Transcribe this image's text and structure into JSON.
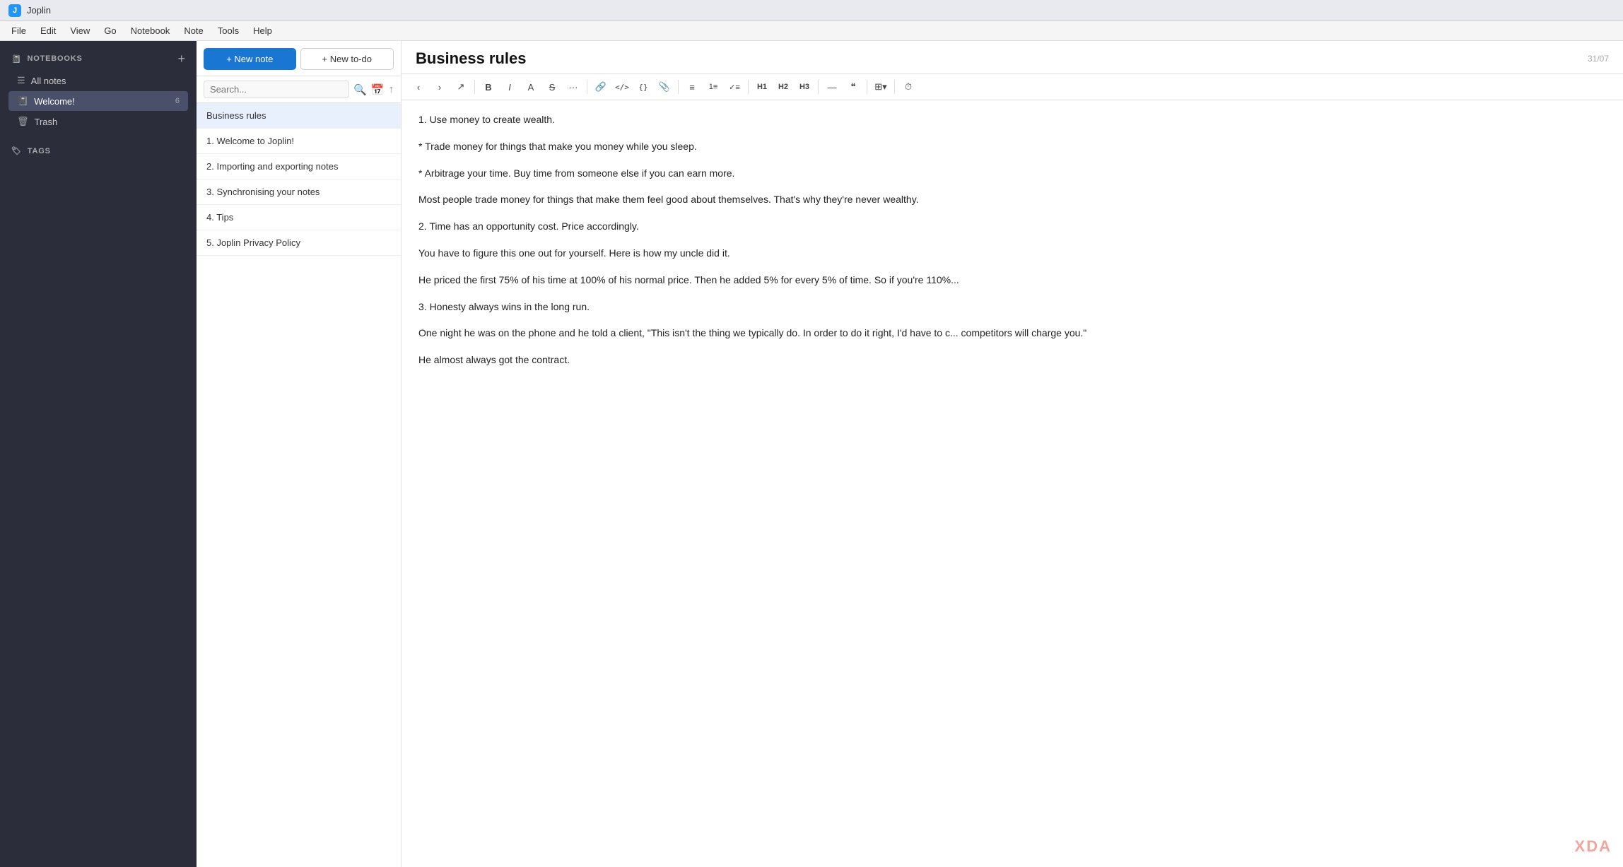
{
  "app": {
    "icon": "J",
    "title": "Joplin"
  },
  "menu": {
    "items": [
      "File",
      "Edit",
      "View",
      "Go",
      "Notebook",
      "Note",
      "Tools",
      "Help"
    ]
  },
  "sidebar": {
    "notebooks_label": "NOTEBOOKS",
    "add_label": "+",
    "items": [
      {
        "id": "all-notes",
        "icon": "☰",
        "label": "All notes",
        "badge": ""
      },
      {
        "id": "welcome",
        "icon": "📓",
        "label": "Welcome!",
        "badge": "6"
      },
      {
        "id": "trash",
        "icon": "🗑",
        "label": "Trash",
        "badge": ""
      }
    ],
    "tags_label": "TAGS"
  },
  "notes_toolbar": {
    "new_note_label": "+ New note",
    "new_todo_label": "+ New to-do"
  },
  "search": {
    "placeholder": "Search..."
  },
  "notes": [
    {
      "id": "business-rules",
      "label": "Business rules",
      "active": true
    },
    {
      "id": "welcome-joplin",
      "label": "1. Welcome to Joplin!"
    },
    {
      "id": "importing-exporting",
      "label": "2. Importing and exporting notes"
    },
    {
      "id": "synchronising",
      "label": "3. Synchronising your notes"
    },
    {
      "id": "tips",
      "label": "4. Tips"
    },
    {
      "id": "privacy-policy",
      "label": "5. Joplin Privacy Policy"
    }
  ],
  "editor": {
    "title": "Business rules",
    "wordcount": "31/07",
    "content": [
      "1. Use money to create wealth.",
      "* Trade money for things that make you money while you sleep.",
      "* Arbitrage your time. Buy time from someone else if you can earn more.",
      "Most people trade money for things that make them feel good about themselves. That's why they're never wealthy.",
      "2. Time has an opportunity cost. Price accordingly.",
      "You have to figure this one out for yourself. Here is how my uncle did it.",
      "He priced the first 75% of his time at 100% of his normal price. Then he added 5% for every 5% of time. So if you're 110%...",
      "3. Honesty always wins in the long run.",
      "One night he was on the phone and he told a client, \"This isn't the thing we typically do. In order to do it right, I'd have to c... competitors will charge you.\"",
      "He almost always got the contract."
    ],
    "toolbar": {
      "back": "‹",
      "forward": "›",
      "external": "↗",
      "bold": "B",
      "italic": "I",
      "highlight": "A",
      "strikethrough": "S",
      "more": "···",
      "link": "🔗",
      "code": "</>",
      "code_block": "{}",
      "attachment": "📎",
      "ul": "≡",
      "ol": "1≡",
      "check": "✓≡",
      "h1": "H1",
      "h2": "H2",
      "h3": "H3",
      "hr": "—",
      "quote": "❝",
      "table": "⊞",
      "clock": "⏱"
    }
  },
  "watermark": "XDA"
}
